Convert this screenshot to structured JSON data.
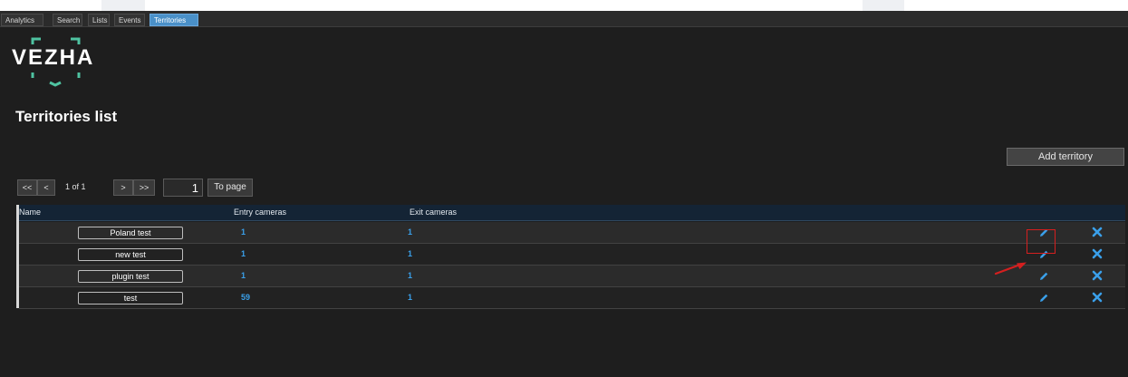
{
  "tabs": [
    {
      "label": "Analytics"
    },
    {
      "label": "Search"
    },
    {
      "label": "Lists"
    },
    {
      "label": "Events"
    },
    {
      "label": "Territories",
      "active": true
    }
  ],
  "logo": {
    "text": "VEZHA",
    "accent_color": "#4fc3a1"
  },
  "page_title": "Territories list",
  "add_button_label": "Add territory",
  "pagination": {
    "first_label": "<<",
    "prev_label": "<",
    "page_info": "1 of 1",
    "next_label": ">",
    "last_label": ">>",
    "page_input_value": "1",
    "to_page_label": "To page"
  },
  "table": {
    "headers": {
      "name": "Name",
      "entry_cameras": "Entry cameras",
      "exit_cameras": "Exit cameras"
    },
    "rows": [
      {
        "name": "Poland test",
        "entry_cameras": "1",
        "exit_cameras": "1"
      },
      {
        "name": "new test",
        "entry_cameras": "1",
        "exit_cameras": "1"
      },
      {
        "name": "plugin test",
        "entry_cameras": "1",
        "exit_cameras": "1"
      },
      {
        "name": "test",
        "entry_cameras": "59",
        "exit_cameras": "1"
      }
    ],
    "row_actions": {
      "edit_icon": "pencil-icon",
      "delete_icon": "close-x-icon"
    }
  },
  "colors": {
    "link_blue": "#3aa0ea",
    "active_tab": "#4a90c8",
    "annotation_red": "#d51f1f",
    "background": "#1e1e1e"
  }
}
